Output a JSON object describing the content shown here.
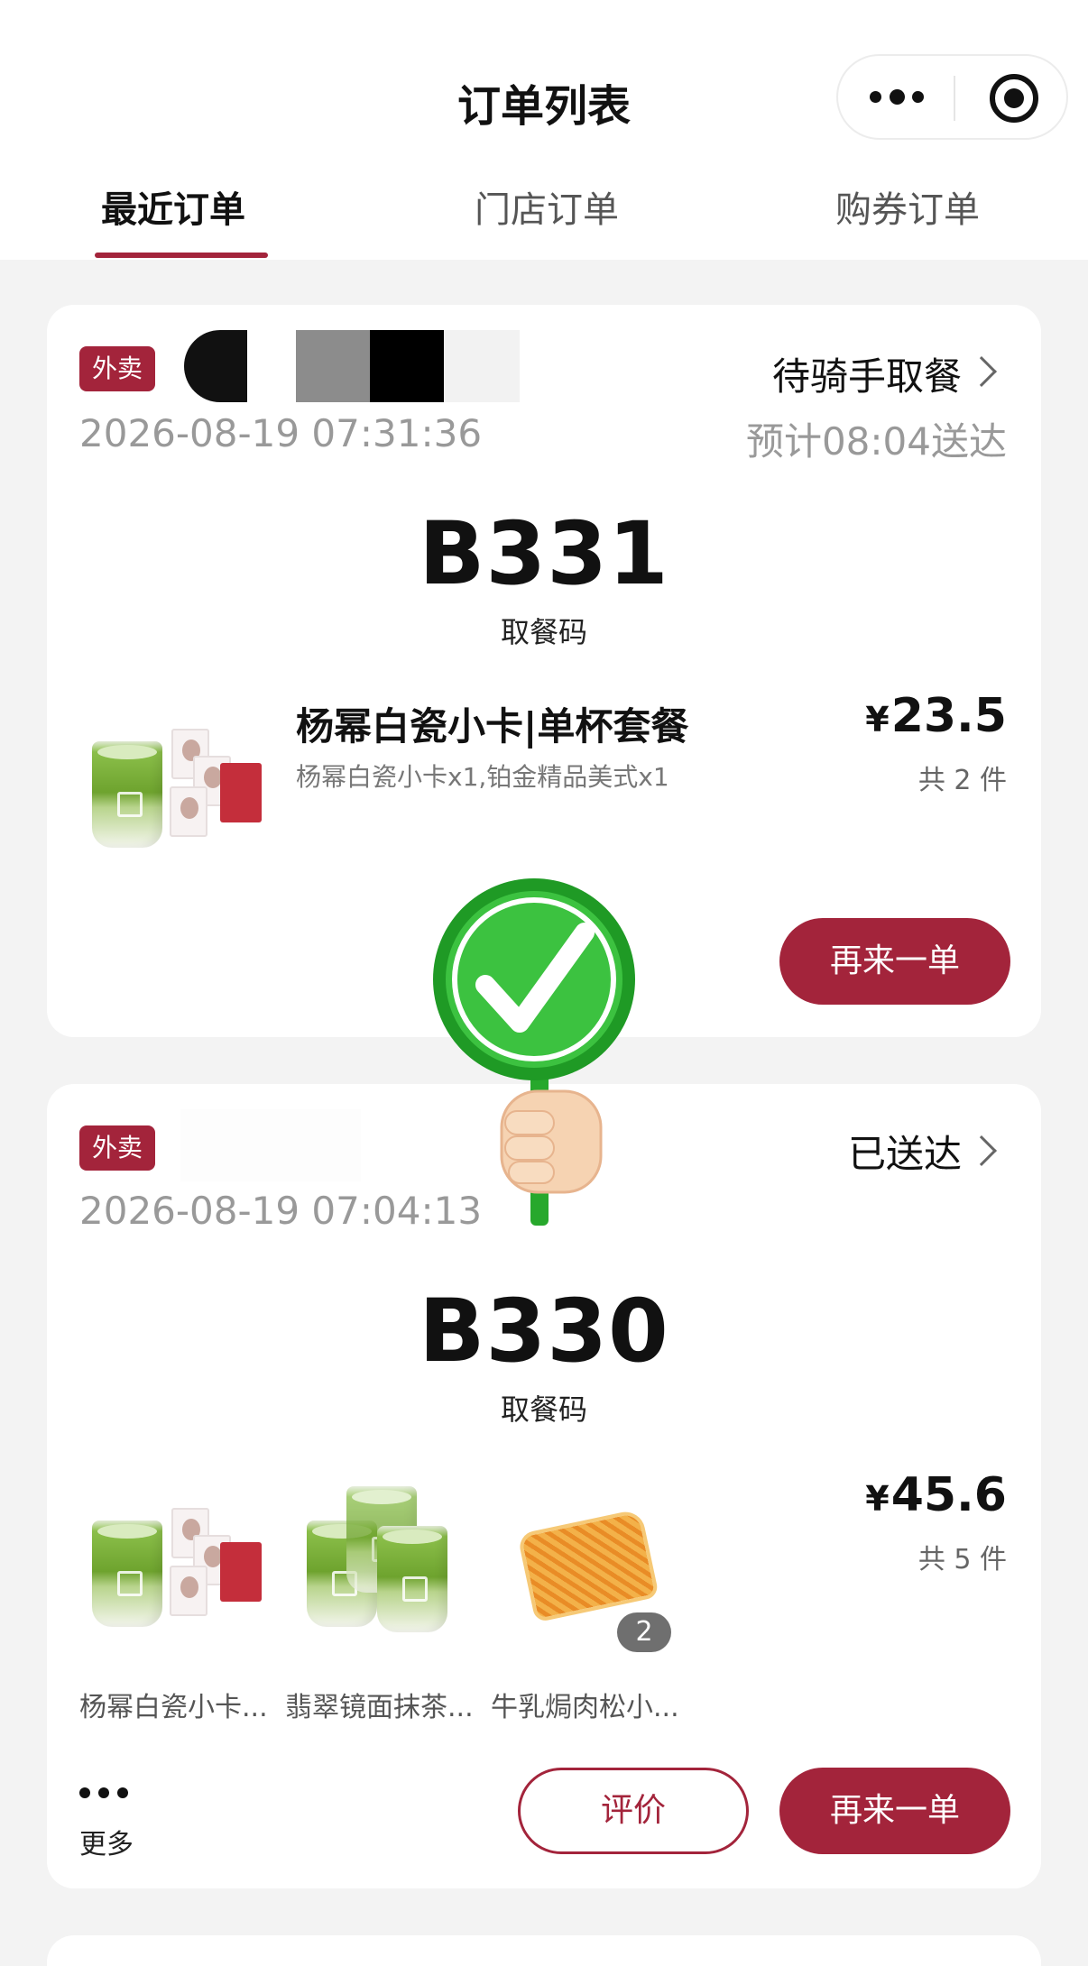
{
  "header": {
    "title": "订单列表",
    "capsule": {
      "more_icon": "more-dots-icon",
      "close_icon": "target-circle-icon"
    }
  },
  "tabs": [
    {
      "label": "最近订单",
      "active": true
    },
    {
      "label": "门店订单",
      "active": false
    },
    {
      "label": "购券订单",
      "active": false
    }
  ],
  "orders": [
    {
      "type_badge": "外卖",
      "status": "待骑手取餐",
      "time": "2026-08-19 07:31:36",
      "eta": "预计08:04送达",
      "pickup_code": "B331",
      "pickup_label": "取餐码",
      "product_name": "杨幂白瓷小卡|单杯套餐",
      "product_spec": "杨幂白瓷小卡x1,铂金精品美式x1",
      "price_symbol": "¥",
      "price": "23.5",
      "count": "共 2 件",
      "reorder_label": "再来一单"
    },
    {
      "type_badge": "外卖",
      "status": "已送达",
      "time": "2026-08-19 07:04:13",
      "pickup_code": "B330",
      "pickup_label": "取餐码",
      "items": [
        {
          "caption": "杨幂白瓷小卡..."
        },
        {
          "caption": "翡翠镜面抹茶..."
        },
        {
          "caption": "牛乳焗肉松小...",
          "quantity": "2"
        }
      ],
      "price_symbol": "¥",
      "price": "45.6",
      "count": "共 5 件",
      "more_label": "更多",
      "review_label": "评价",
      "reorder_label": "再来一单"
    }
  ],
  "colors": {
    "accent": "#a3243b",
    "badge_bg": "#a3243b",
    "page_bg": "#f3f3f3",
    "check_green": "#2fb533"
  }
}
